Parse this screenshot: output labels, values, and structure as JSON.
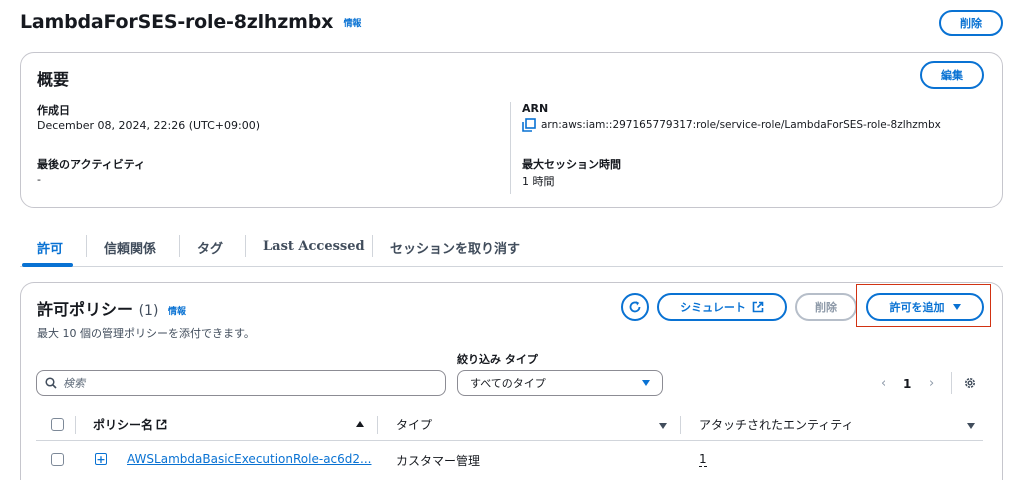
{
  "header": {
    "role_name": "LambdaForSES-role-8zlhzmbx",
    "info_label": "情報",
    "delete_label": "削除"
  },
  "summary": {
    "title": "概要",
    "edit_label": "編集",
    "created_label": "作成日",
    "created_value": "December 08, 2024, 22:26 (UTC+09:00)",
    "last_activity_label": "最後のアクティビティ",
    "last_activity_value": "-",
    "arn_label": "ARN",
    "arn_value": "arn:aws:iam::297165779317:role/service-role/LambdaForSES-role-8zlhzmbx",
    "max_session_label": "最大セッション時間",
    "max_session_value": "1 時間"
  },
  "tabs": [
    {
      "label": "許可",
      "active": true
    },
    {
      "label": "信頼関係",
      "active": false
    },
    {
      "label": "タグ",
      "active": false
    },
    {
      "label": "Last Accessed",
      "active": false
    },
    {
      "label": "セッションを取り消す",
      "active": false
    }
  ],
  "policies": {
    "title": "許可ポリシー",
    "count": "(1)",
    "info_label": "情報",
    "description": "最大 10 個の管理ポリシーを添付できます。",
    "simulate_label": "シミュレート",
    "delete_label": "削除",
    "add_label": "許可を追加",
    "filter_type_label": "絞り込み タイプ",
    "search_placeholder": "検索",
    "type_select_value": "すべてのタイプ",
    "page_number": "1",
    "columns": {
      "policy_name": "ポリシー名",
      "type": "タイプ",
      "attached_entities": "アタッチされたエンティティ"
    },
    "rows": [
      {
        "policy_name": "AWSLambdaBasicExecutionRole-ac6d2...",
        "type": "カスタマー管理",
        "attached_entities": "1"
      }
    ]
  },
  "colors": {
    "accent": "#0972d3",
    "highlight_border": "#d13212"
  }
}
